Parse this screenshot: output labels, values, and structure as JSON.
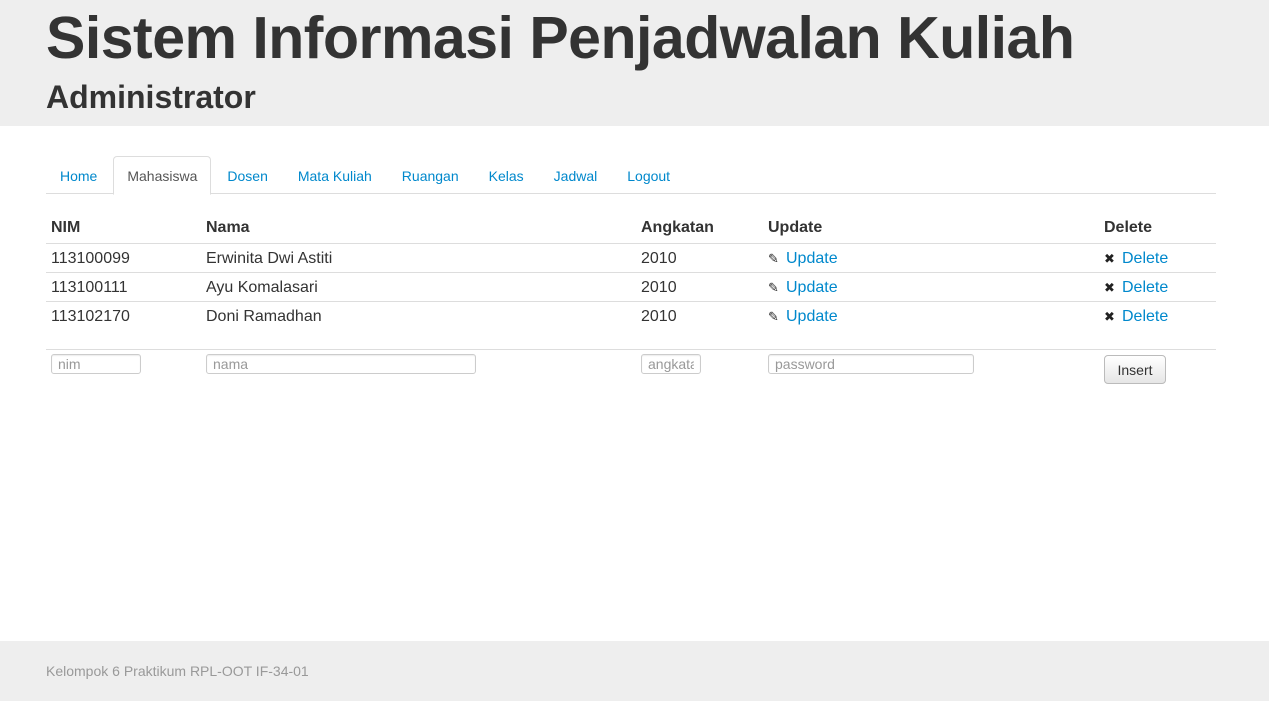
{
  "header": {
    "title": "Sistem Informasi Penjadwalan Kuliah",
    "subtitle": "Administrator"
  },
  "nav": {
    "tabs": [
      {
        "label": "Home",
        "active": false
      },
      {
        "label": "Mahasiswa",
        "active": true
      },
      {
        "label": "Dosen",
        "active": false
      },
      {
        "label": "Mata Kuliah",
        "active": false
      },
      {
        "label": "Ruangan",
        "active": false
      },
      {
        "label": "Kelas",
        "active": false
      },
      {
        "label": "Jadwal",
        "active": false
      },
      {
        "label": "Logout",
        "active": false
      }
    ]
  },
  "table": {
    "columns": [
      "NIM",
      "Nama",
      "Angkatan",
      "Update",
      "Delete"
    ],
    "rows": [
      {
        "nim": "113100099",
        "nama": "Erwinita Dwi Astiti",
        "angkatan": "2010",
        "update": "Update",
        "delete": "Delete"
      },
      {
        "nim": "113100111",
        "nama": "Ayu Komalasari",
        "angkatan": "2010",
        "update": "Update",
        "delete": "Delete"
      },
      {
        "nim": "113102170",
        "nama": "Doni Ramadhan",
        "angkatan": "2010",
        "update": "Update",
        "delete": "Delete"
      }
    ]
  },
  "form": {
    "nim_placeholder": "nim",
    "nama_placeholder": "nama",
    "angkatan_placeholder": "angkatan",
    "password_placeholder": "password",
    "insert_label": "Insert"
  },
  "icons": {
    "update": "pencil-icon",
    "delete": "cross-icon"
  },
  "colors": {
    "link": "#0088cc",
    "header_bg": "#eeeeee"
  },
  "footer": {
    "text": "Kelompok 6 Praktikum RPL-OOT IF-34-01"
  }
}
